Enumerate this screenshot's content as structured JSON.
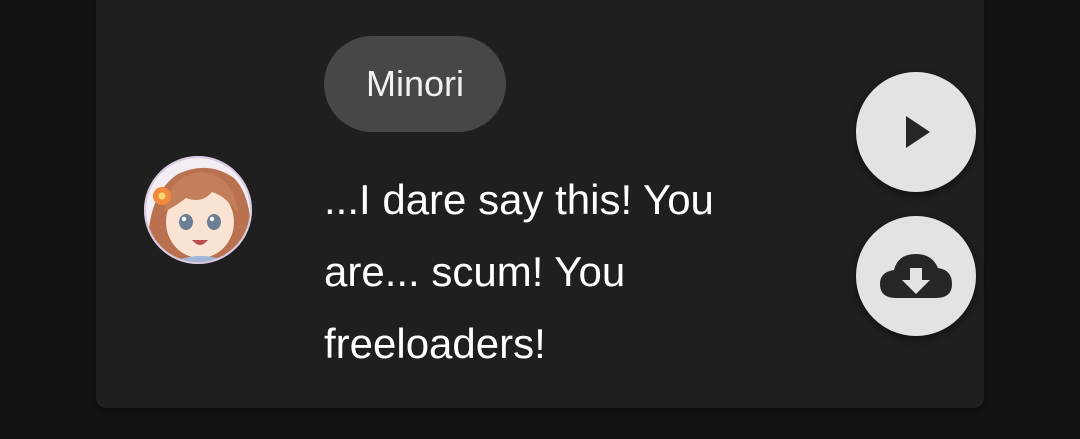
{
  "entry": {
    "speaker": "Minori",
    "message": "...I dare say this! You are... scum! You freeloaders!",
    "avatar": "character-portrait"
  },
  "actions": {
    "play_icon": "play-icon",
    "download_icon": "cloud-download-icon"
  },
  "colors": {
    "background": "#121212",
    "card": "#1f1f1f",
    "chip": "#474747",
    "fab": "#e3e3e3",
    "icon": "#262626"
  }
}
